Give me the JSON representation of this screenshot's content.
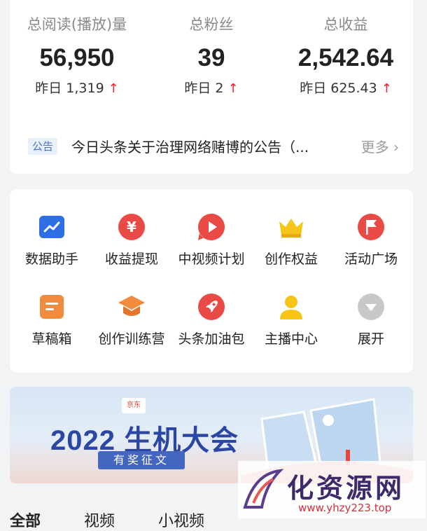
{
  "stats": [
    {
      "label": "总阅读(播放)量",
      "value": "56,950",
      "yesterday": "昨日 1,319"
    },
    {
      "label": "总粉丝",
      "value": "39",
      "yesterday": "昨日 2"
    },
    {
      "label": "总收益",
      "value": "2,542.64",
      "yesterday": "昨日 625.43"
    }
  ],
  "notice": {
    "badge": "公告",
    "text": "今日头条关于治理网络赌博的公告（...",
    "more": "更多"
  },
  "tools": [
    {
      "label": "数据助手",
      "icon": "chart-icon"
    },
    {
      "label": "收益提现",
      "icon": "yuan-icon"
    },
    {
      "label": "中视频计划",
      "icon": "play-icon"
    },
    {
      "label": "创作权益",
      "icon": "crown-icon"
    },
    {
      "label": "活动广场",
      "icon": "flag-icon"
    },
    {
      "label": "草稿箱",
      "icon": "draft-icon"
    },
    {
      "label": "创作训练营",
      "icon": "graduation-cap-icon"
    },
    {
      "label": "头条加油包",
      "icon": "rocket-icon"
    },
    {
      "label": "主播中心",
      "icon": "person-icon"
    },
    {
      "label": "展开",
      "icon": "chevron-down-icon"
    }
  ],
  "banner": {
    "logo": "京东",
    "title": "2022 生机大会",
    "subtitle": "有奖征文"
  },
  "watermark": {
    "text": "化资源网",
    "url": "www.yhzy223.top"
  },
  "tabs": [
    "全部",
    "视频",
    "小视频"
  ],
  "colors": {
    "accent_red": "#e8232f",
    "blue": "#2f6fe4",
    "orange": "#f08a3c",
    "yellow": "#f5c518"
  }
}
